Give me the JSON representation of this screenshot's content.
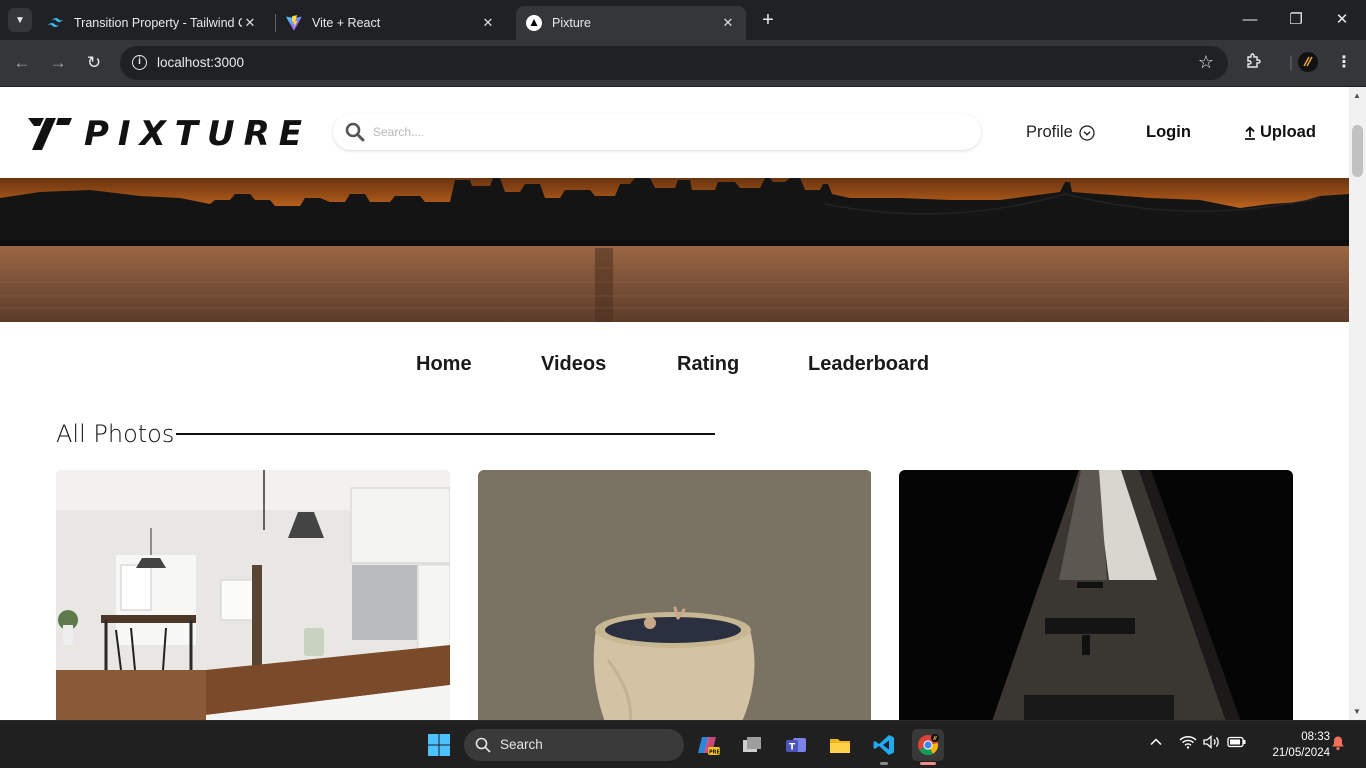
{
  "browser": {
    "tabs": [
      {
        "title": "Transition Property - Tailwind CSS",
        "active": false
      },
      {
        "title": "Vite + React",
        "active": false
      },
      {
        "title": "Pixture",
        "active": true
      }
    ],
    "url": "localhost:3000"
  },
  "site": {
    "logo_text": "PIXTURE",
    "search_placeholder": "Search....",
    "profile_label": "Profile",
    "login_label": "Login",
    "upload_label": "Upload",
    "nav": [
      "Home",
      "Videos",
      "Rating",
      "Leaderboard"
    ],
    "section_title": "All Photos",
    "photos": [
      {
        "subject": "kitchen-interior"
      },
      {
        "subject": "clay-pot-with-figure"
      },
      {
        "subject": "concrete-tower-dark"
      }
    ]
  },
  "taskbar": {
    "search_label": "Search",
    "time": "08:33",
    "date": "21/05/2024"
  },
  "colors": {
    "browser_bg": "#202124",
    "toolbar_bg": "#35363a",
    "taskbar_bg": "#202020",
    "text_dark": "#111111"
  }
}
